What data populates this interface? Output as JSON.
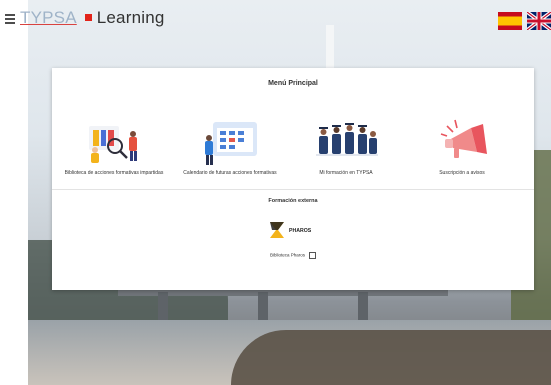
{
  "header": {
    "logo_typsa": "TYPSA",
    "logo_learning": "Learning",
    "menu_icon": "hamburger-menu-icon",
    "languages": [
      "es-flag-icon",
      "uk-flag-icon"
    ]
  },
  "panel": {
    "title": "Menú Principal",
    "items": [
      {
        "label": "Biblioteca de acciones formativas impartidas",
        "icon": "library-illustration-icon"
      },
      {
        "label": "Calendario de futuras acciones formativas",
        "icon": "calendar-illustration-icon"
      },
      {
        "label": "Mi formación en TYPSA",
        "icon": "graduates-illustration-icon"
      },
      {
        "label": "Suscripción a avisos",
        "icon": "megaphone-illustration-icon"
      }
    ],
    "external": {
      "title": "Formación externa",
      "logo_text": "PHAROS",
      "link_label": "Biblioteca Pharos"
    }
  },
  "colors": {
    "brand_red": "#e2231a",
    "typsa_blue": "#9fb3c8",
    "pharos_yellow": "#f3b31b"
  }
}
